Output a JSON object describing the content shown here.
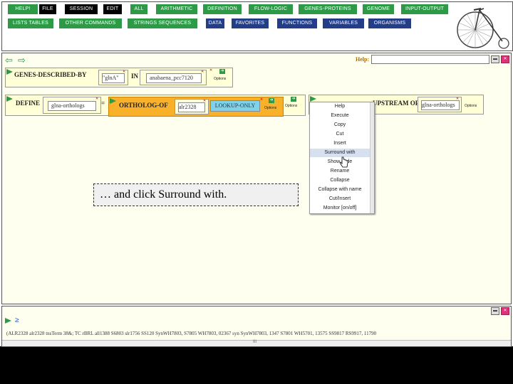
{
  "menu": {
    "row1": [
      {
        "label": "HELP!",
        "style": "green"
      },
      {
        "label": "FILE",
        "style": "black"
      },
      {
        "label": "SESSION",
        "style": "black"
      },
      {
        "label": "EDIT",
        "style": "black"
      },
      {
        "label": "ALL",
        "style": "green"
      },
      {
        "label": "ARITHMETIC",
        "style": "green"
      },
      {
        "label": "DEFINITION",
        "style": "green"
      },
      {
        "label": "FLOW-LOGIC",
        "style": "green"
      },
      {
        "label": "GENES-PROTEINS",
        "style": "green"
      },
      {
        "label": "GENOME",
        "style": "green"
      },
      {
        "label": "INPUT-OUTPUT",
        "style": "green"
      }
    ],
    "row2": [
      {
        "label": "LISTS TABLES",
        "style": "green"
      },
      {
        "label": "OTHER COMMANDS",
        "style": "green"
      },
      {
        "label": "STRINGS SEQUENCES",
        "style": "green"
      },
      {
        "label": "DATA",
        "style": "blue"
      },
      {
        "label": "FAVORITES",
        "style": "blue"
      },
      {
        "label": "FUNCTIONS",
        "style": "blue"
      },
      {
        "label": "VARIABLES",
        "style": "blue"
      },
      {
        "label": "ORGANISMS",
        "style": "blue"
      }
    ]
  },
  "workspace": {
    "help_label": "Help:",
    "box1": {
      "title": "GENES-DESCRIBED-BY",
      "arg1": "\"glnA\"",
      "in_label": "IN",
      "arg2": "anabaena_pcc7120",
      "options": "Options"
    },
    "box2": {
      "title": "DEFINE",
      "var": "glna-orthologs",
      "eq": "=",
      "inner_title": "ORTHOLOG-OF",
      "inner_arg": "alr2328",
      "lookup": "LOOKUP-ONLY",
      "options_inner": "Options",
      "options_outer": "Options"
    },
    "box3": {
      "title": "... UPSTREAM OF",
      "arg": "glna-orthologs",
      "options": "Options"
    }
  },
  "context_menu": {
    "items": [
      "Help",
      "Execute",
      "Copy",
      "Cut",
      "Insert",
      "Surround with",
      "Show code",
      "Rename",
      "Collapse",
      "Collapse with name",
      "Cut/Insert",
      "Monitor [on/off]"
    ],
    "highlighted": "Surround with"
  },
  "callout": "… and click Surround with.",
  "bottom": {
    "prompt": "≥",
    "result": "(ALR2328 alr2328 tnsTerm 38&; TC rBRL all1388 S6803 slr1756 SS120 SynWH7803, S7805 WH7803, 02367 syn SynWH7803, 1347 S7801 WH5701, 13575 SS9817 RS9917, 11790",
    "scroll_mark": "III"
  }
}
